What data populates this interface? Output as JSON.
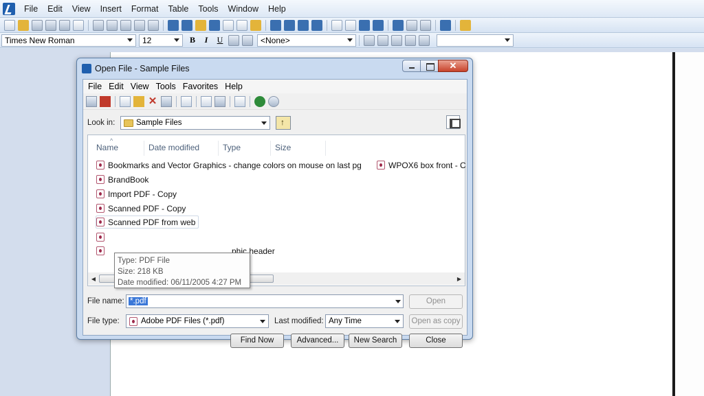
{
  "app": {
    "menu": [
      "File",
      "Edit",
      "View",
      "Insert",
      "Format",
      "Table",
      "Tools",
      "Window",
      "Help"
    ],
    "font_name": "Times New Roman",
    "font_size": "12",
    "bold_label": "B",
    "italic_label": "I",
    "underline_label": "U",
    "style_value": "<None>"
  },
  "dialog": {
    "title": "Open File - Sample Files",
    "close_glyph": "✕",
    "menu": [
      "File",
      "Edit",
      "View",
      "Tools",
      "Favorites",
      "Help"
    ],
    "look_in_label": "Look in:",
    "look_in_value": "Sample Files",
    "columns": [
      "Name",
      "Date modified",
      "Type",
      "Size"
    ],
    "files": [
      "Bookmarks and Vector Graphics - change colors on mouse on last pg",
      "BrandBook",
      "Import PDF - Copy",
      "Scanned PDF - Copy",
      "Scanned PDF from web",
      "",
      "phic header"
    ],
    "files_col2": [
      "WPOX6 box front - C"
    ],
    "tooltip": {
      "type": "Type: PDF File",
      "size": "Size: 218 KB",
      "modified": "Date modified: 06/11/2005 4:27 PM"
    },
    "file_name_label": "File name:",
    "file_name_value": "*.pdf",
    "file_type_label": "File type:",
    "file_type_value": "Adobe PDF Files (*.pdf)",
    "last_modified_label": "Last modified:",
    "last_modified_value": "Any Time",
    "buttons": {
      "open": "Open",
      "open_as_copy": "Open as copy",
      "find_now": "Find Now",
      "advanced": "Advanced...",
      "new_search": "New Search",
      "close": "Close"
    }
  }
}
